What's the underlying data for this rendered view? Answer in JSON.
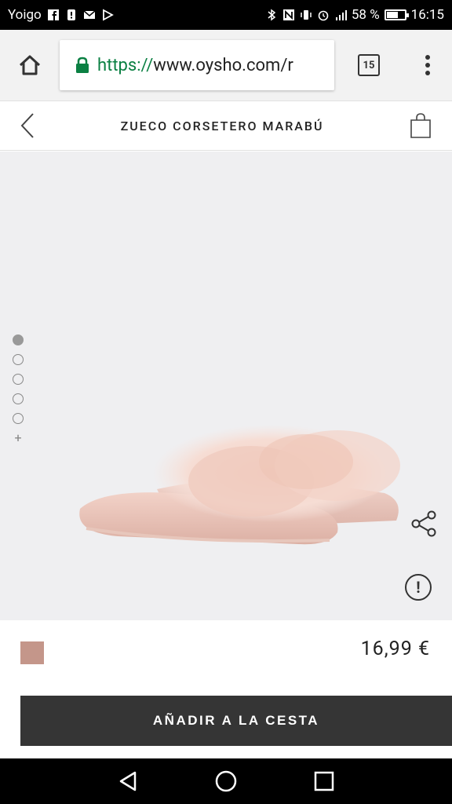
{
  "status_bar": {
    "carrier": "Yoigo",
    "battery_percent": "58 %",
    "battery_level": 0.58,
    "time": "16:15"
  },
  "browser": {
    "url_scheme": "https://",
    "url_domain": "www.oysho.com/r",
    "tab_count": "15",
    "secure_color": "#0b8043"
  },
  "header": {
    "product_title": "ZUECO CORSETERO MARABÚ"
  },
  "gallery": {
    "image_count": 5,
    "active_index": 0,
    "more_label": "+"
  },
  "product": {
    "swatch_color": "#c4968a",
    "price": "16,99 €"
  },
  "actions": {
    "add_to_cart_label": "AÑADIR A LA CESTA",
    "info_label": "!"
  }
}
